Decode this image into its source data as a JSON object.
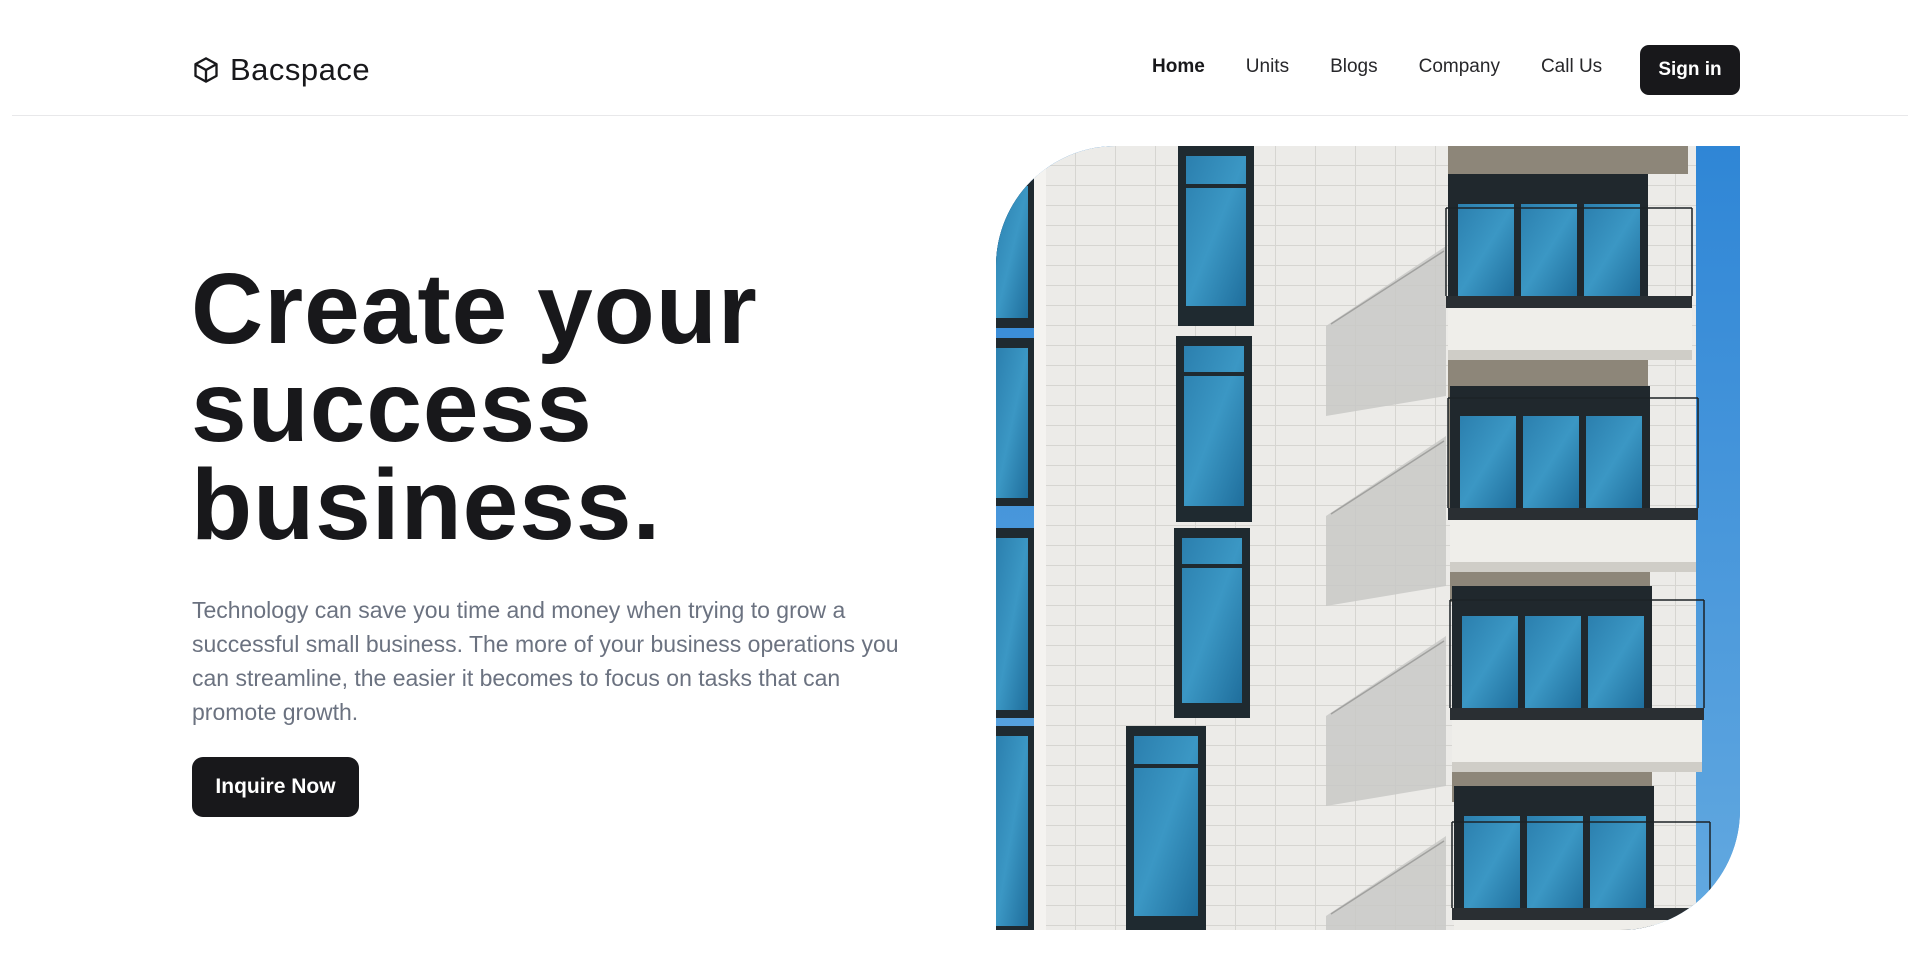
{
  "brand": {
    "name": "Bacspace",
    "icon": "cube-icon"
  },
  "nav": {
    "links": [
      {
        "label": "Home",
        "active": true
      },
      {
        "label": "Units",
        "active": false
      },
      {
        "label": "Blogs",
        "active": false
      },
      {
        "label": "Company",
        "active": false
      },
      {
        "label": "Call Us",
        "active": false
      }
    ],
    "signin_label": "Sign in"
  },
  "hero": {
    "title_lines": [
      "Create your",
      "success",
      "business."
    ],
    "description": "Technology can save you time and money when trying to grow a successful small business. The more of your business operations you can streamline, the easier it becomes to focus on tasks that can promote growth.",
    "cta_label": "Inquire Now",
    "image": "building-facade-photo"
  },
  "colors": {
    "primary": "#18181b",
    "text_muted": "#6b7280",
    "sky": "#3f8fd4",
    "facade": "#ededeb",
    "glass": "#2f86b4"
  }
}
